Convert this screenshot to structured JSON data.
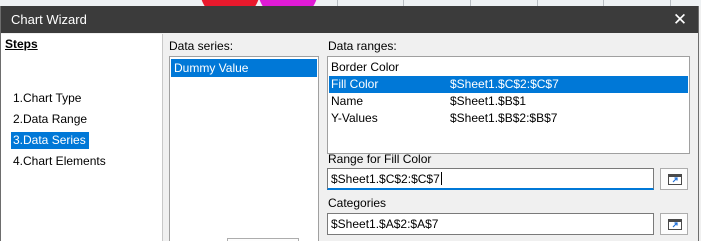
{
  "dialog": {
    "title": "Chart Wizard",
    "close_glyph": "✕"
  },
  "steps": {
    "heading": "Steps",
    "items": [
      {
        "label": "1.Chart Type",
        "selected": false
      },
      {
        "label": "2.Data Range",
        "selected": false
      },
      {
        "label": "3.Data Series",
        "selected": true
      },
      {
        "label": "4.Chart Elements",
        "selected": false
      }
    ]
  },
  "data_series": {
    "label": "Data series:",
    "items": [
      {
        "label": "Dummy Value",
        "selected": true
      }
    ]
  },
  "data_ranges": {
    "label": "Data ranges:",
    "rows": [
      {
        "role": "Border Color",
        "range": "",
        "selected": false
      },
      {
        "role": "Fill Color",
        "range": "$Sheet1.$C$2:$C$7",
        "selected": true
      },
      {
        "role": "Name",
        "range": "$Sheet1.$B$1",
        "selected": false
      },
      {
        "role": "Y-Values",
        "range": "$Sheet1.$B$2:$B$7",
        "selected": false
      }
    ]
  },
  "range_for": {
    "label": "Range for Fill Color",
    "value": "$Sheet1.$C$2:$C$7"
  },
  "categories": {
    "label": "Categories",
    "value": "$Sheet1.$A$2:$A$7"
  },
  "colors": {
    "titlebar_bg": "#3b3b3b",
    "selection": "#0078d7",
    "dialog_bg": "#f0f0f0"
  },
  "icons": {
    "close": "close-icon",
    "range_picker": "shrink-range-icon"
  }
}
